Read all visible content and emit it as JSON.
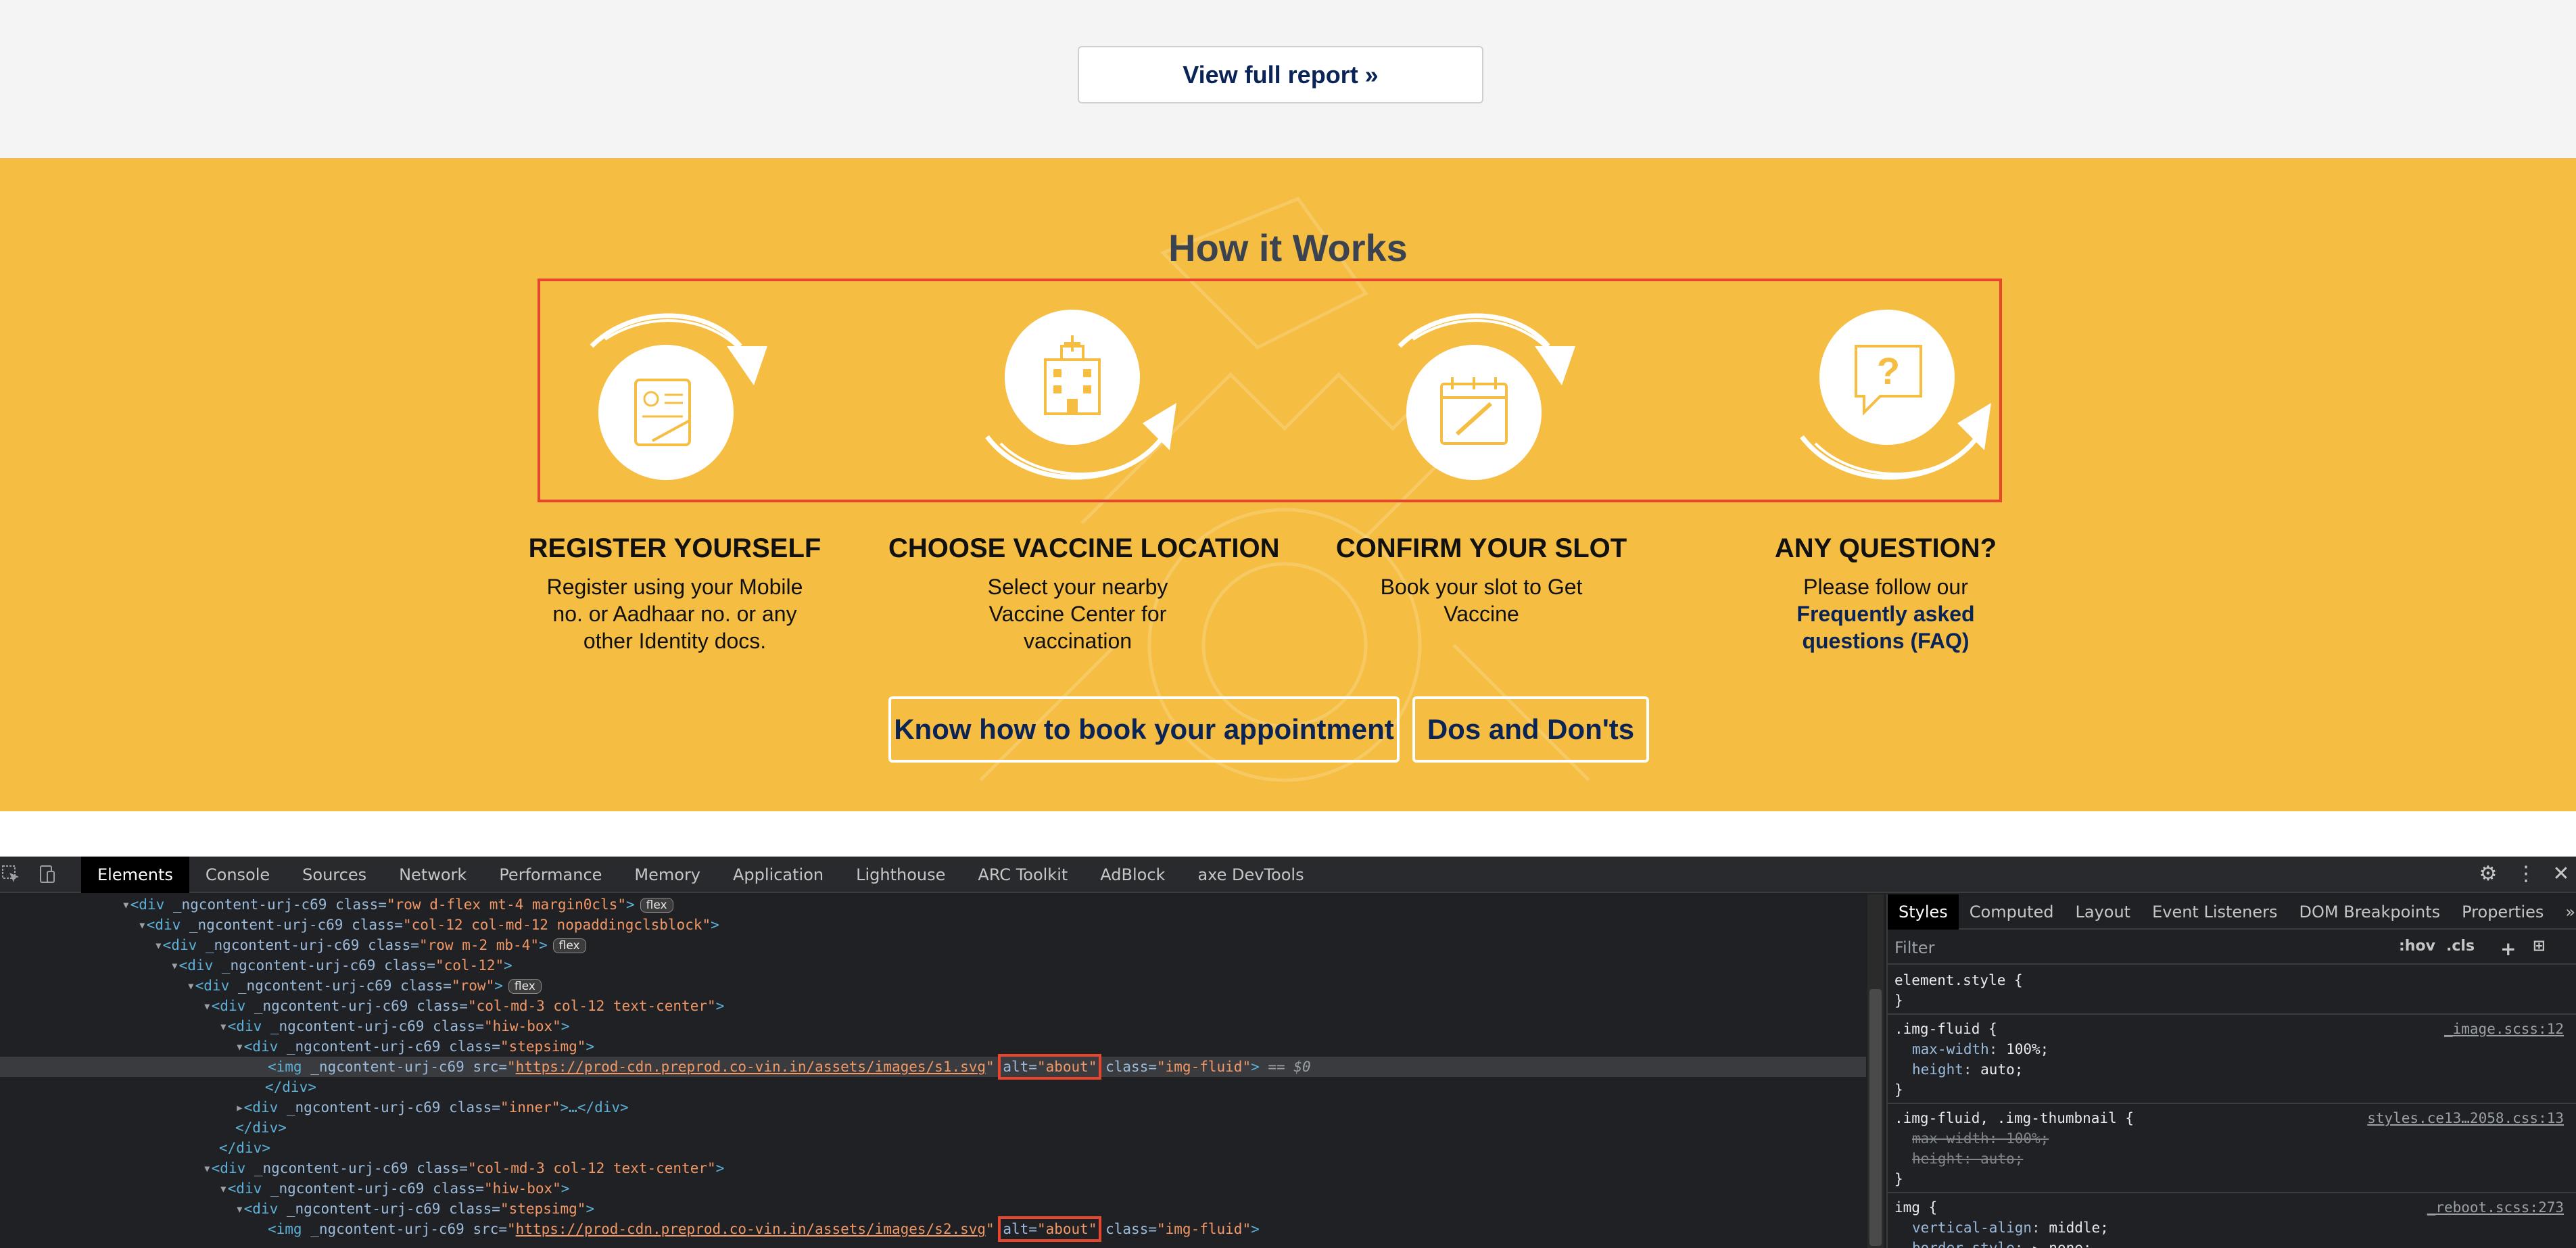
{
  "top": {
    "view_report_label": "View full report »"
  },
  "how_it_works": {
    "title": "How it Works",
    "steps": [
      {
        "title": "REGISTER YOURSELF",
        "desc": "Register using your Mobile no. or Aadhaar no. or any other Identity docs.",
        "icon": "register-id-card-icon"
      },
      {
        "title": "CHOOSE VACCINE LOCATION",
        "desc": "Select your nearby Vaccine Center for vaccination",
        "icon": "hospital-icon"
      },
      {
        "title": "CONFIRM YOUR SLOT",
        "desc": "Book your slot to Get Vaccine",
        "icon": "calendar-icon"
      },
      {
        "title": "ANY QUESTION?",
        "desc": "Please follow our",
        "link": "Frequently asked questions (FAQ)",
        "icon": "question-bubble-icon"
      }
    ],
    "cta_book": "Know how to book your appointment",
    "cta_dos": "Dos and Don'ts"
  },
  "devtools": {
    "tabs": [
      "Elements",
      "Console",
      "Sources",
      "Network",
      "Performance",
      "Memory",
      "Application",
      "Lighthouse",
      "ARC Toolkit",
      "AdBlock",
      "axe DevTools"
    ],
    "active_tab": "Elements",
    "dom": {
      "l1_class": "row d-flex mt-4 margin0cls",
      "l2_class": "col-12 col-md-12 nopaddingclsblock",
      "l3_class": "row m-2 mb-4",
      "l4_class": "col-12",
      "l5_class": "row",
      "l6_class": "col-md-3 col-12 text-center",
      "l7_class": "hiw-box",
      "l8_class": "stepsimg",
      "img1_src": "https://prod-cdn.preprod.co-vin.in/assets/images/s1.svg",
      "img2_src": "https://prod-cdn.preprod.co-vin.in/assets/images/s2.svg",
      "img_alt": "about",
      "img_class": "img-fluid",
      "inner_class": "inner",
      "ng_attr": "_ngcontent-urj-c69",
      "flex_badge": "flex",
      "selected_marker": "== $0"
    },
    "styles_tabs": [
      "Styles",
      "Computed",
      "Layout",
      "Event Listeners",
      "DOM Breakpoints",
      "Properties"
    ],
    "filter_placeholder": "Filter",
    "filter_hov": ":hov",
    "filter_cls": ".cls",
    "rules": {
      "element_style": "element.style {",
      "r1_selector": ".img-fluid {",
      "r1_src": "_image.scss:12",
      "r1_p1": "max-width",
      "r1_v1": "100%;",
      "r1_p2": "height",
      "r1_v2": "auto;",
      "r2_selector": ".img-fluid, .img-thumbnail {",
      "r2_src": "styles.ce13…2058.css:13",
      "r2_p1": "max-width: 100%;",
      "r2_p2": "height: auto;",
      "r3_selector": "img {",
      "r3_src": "_reboot.scss:273",
      "r3_p1": "vertical-align",
      "r3_v1": "middle;",
      "r3_p2": "border-style",
      "r3_v2": "▸ none;"
    }
  }
}
